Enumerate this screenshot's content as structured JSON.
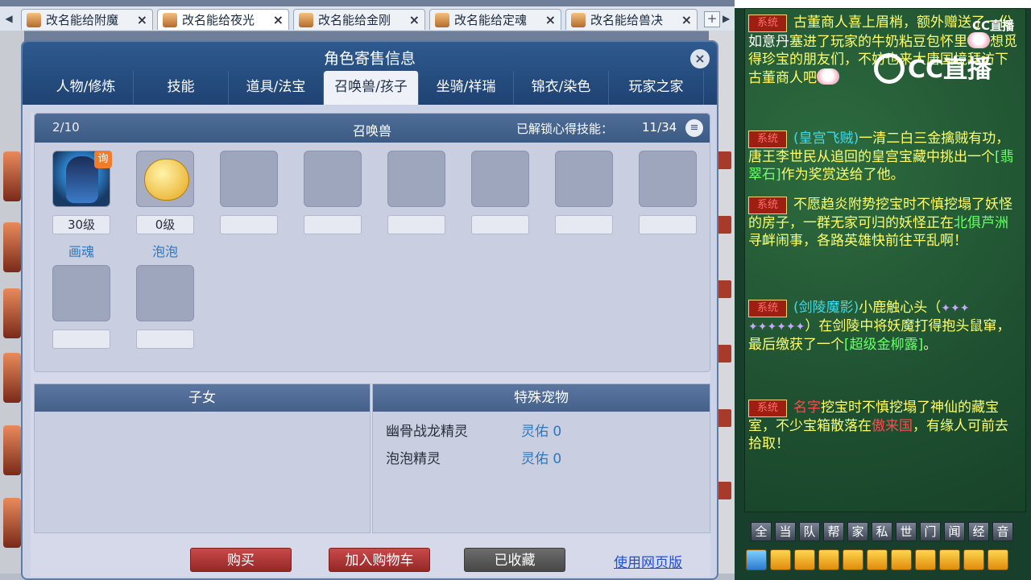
{
  "browser_tabs": [
    {
      "label": "改名能给附魔",
      "active": false
    },
    {
      "label": "改名能给夜光",
      "active": true
    },
    {
      "label": "改名能给金刚",
      "active": false
    },
    {
      "label": "改名能给定魂",
      "active": false
    },
    {
      "label": "改名能给兽决",
      "active": false
    }
  ],
  "icons": {
    "close": "×",
    "add_tab": "+",
    "menu": "≡",
    "nav_left": "◀",
    "nav_right": "▶"
  },
  "window": {
    "title": "角色寄售信息",
    "nav": [
      "人物/修炼",
      "技能",
      "道具/法宝",
      "召唤兽/孩子",
      "坐骑/祥瑞",
      "锦衣/染色",
      "玩家之家"
    ],
    "active_nav": "召唤兽/孩子"
  },
  "pets": {
    "count": "2/10",
    "title": "召唤兽",
    "skills_label": "已解锁心得技能：",
    "skills_count": "11/34",
    "badge": "询",
    "list": [
      {
        "level": "30级",
        "name": "画魂"
      },
      {
        "level": "0级",
        "name": "泡泡"
      }
    ]
  },
  "children": {
    "title": "子女"
  },
  "special_pets": {
    "title": "特殊宠物",
    "rows": [
      {
        "name": "幽骨战龙精灵",
        "value": "灵佑 0"
      },
      {
        "name": "泡泡精灵",
        "value": "灵佑 0"
      }
    ]
  },
  "actions": {
    "buy": "购买",
    "add_cart": "加入购物车",
    "favorited": "已收藏",
    "web_version": "使用网页版"
  },
  "chat": {
    "system_tag": "系统",
    "messages": [
      {
        "parts": [
          "古董商人喜上眉梢，额外赠送了一份",
          "如意丹",
          "塞进了玩家的牛奶粘豆包怀里",
          "想觅得珍宝的朋友们，不妨也来大唐国境拜访下古董商人吧"
        ]
      },
      {
        "parts": [
          "(皇宫飞贼)",
          "一清二白三金擒贼有功，唐王李世民从追回的皇宫宝藏中挑出一个",
          "[翡翠石]",
          "作为奖赏送给了他。"
        ]
      },
      {
        "parts": [
          "不愿趋炎附势挖宝时不慎挖塌了妖怪的房子，一群无家可归的妖怪正在",
          "北俱芦洲",
          "寻衅闹事，各路英雄快前往平乱啊！"
        ]
      },
      {
        "parts": [
          "(剑陵魔影)",
          "小鹿触心头（",
          "）在剑陵中将妖魔打得抱头鼠窜，最后缴获了一个",
          "[超级金柳露]",
          "。"
        ]
      },
      {
        "parts": [
          "名字",
          "挖宝时不慎挖塌了神仙的藏宝室，不少宝箱散落在",
          "傲来国",
          "，有缘人可前去拾取！"
        ]
      }
    ],
    "channels": [
      "全",
      "当",
      "队",
      "帮",
      "家",
      "私",
      "世",
      "门",
      "闻",
      "经",
      "音"
    ],
    "watermark": "CC直播",
    "watermark_small": "CC直播"
  },
  "colors": {
    "window_header": "#2e5a8f",
    "chat_bg": "#1f5131",
    "chat_text": "#ffff6b",
    "buy_button": "#c84a4a",
    "link": "#1f4fd6"
  }
}
